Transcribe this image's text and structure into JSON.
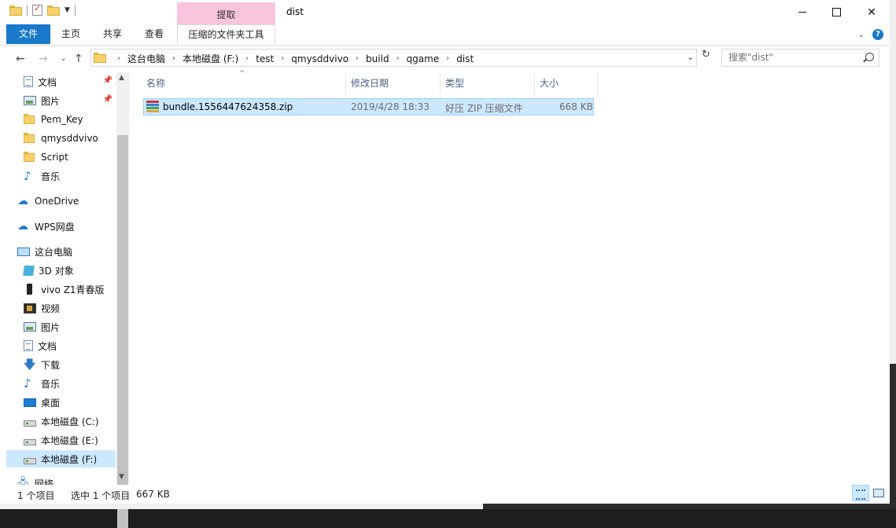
{
  "window": {
    "title": "dist",
    "tool_tab_header": "提取",
    "quick_access": [
      "folder-icon",
      "properties-check-icon",
      "new-folder-icon"
    ]
  },
  "ribbon": {
    "tabs": [
      "文件",
      "主页",
      "共享",
      "查看",
      "压缩的文件夹工具"
    ]
  },
  "address": {
    "breadcrumb": [
      "这台电脑",
      "本地磁盘 (F:)",
      "test",
      "qmysddvivo",
      "build",
      "qgame",
      "dist"
    ],
    "search_placeholder": "搜索\"dist\""
  },
  "nav": {
    "items": [
      {
        "label": "文档",
        "icon": "document-icon",
        "pinned": true
      },
      {
        "label": "图片",
        "icon": "picture-icon",
        "pinned": true
      },
      {
        "label": "Pem_Key",
        "icon": "folder-icon"
      },
      {
        "label": "qmysddvivo",
        "icon": "folder-icon"
      },
      {
        "label": "Script",
        "icon": "folder-icon"
      },
      {
        "label": "音乐",
        "icon": "music-icon"
      },
      {
        "label": "OneDrive",
        "icon": "onedrive-cloud-icon"
      },
      {
        "label": "WPS网盘",
        "icon": "wps-cloud-icon"
      },
      {
        "label": "这台电脑",
        "icon": "this-pc-icon"
      },
      {
        "label": "3D 对象",
        "icon": "3d-objects-icon"
      },
      {
        "label": "vivo Z1青春版",
        "icon": "phone-icon"
      },
      {
        "label": "视频",
        "icon": "video-icon"
      },
      {
        "label": "图片",
        "icon": "picture-icon"
      },
      {
        "label": "文档",
        "icon": "document-icon"
      },
      {
        "label": "下载",
        "icon": "download-icon"
      },
      {
        "label": "音乐",
        "icon": "music-icon"
      },
      {
        "label": "桌面",
        "icon": "desktop-icon"
      },
      {
        "label": "本地磁盘 (C:)",
        "icon": "drive-icon"
      },
      {
        "label": "本地磁盘 (E:)",
        "icon": "drive-icon"
      },
      {
        "label": "本地磁盘 (F:)",
        "icon": "drive-icon",
        "selected": true
      },
      {
        "label": "网络",
        "icon": "network-icon"
      }
    ]
  },
  "list": {
    "columns": [
      "名称",
      "修改日期",
      "类型",
      "大小"
    ],
    "rows": [
      {
        "name": "bundle.1556447624358.zip",
        "modified": "2019/4/28 18:33",
        "type": "好压 ZIP 压缩文件",
        "size": "668 KB",
        "selected": true
      }
    ]
  },
  "status": {
    "count": "1 个项目",
    "selected": "选中 1 个项目",
    "size": "667 KB"
  },
  "colors": {
    "accent": "#1979ca",
    "tool_tab": "#f9c5dc",
    "selection": "#cce8ff"
  }
}
